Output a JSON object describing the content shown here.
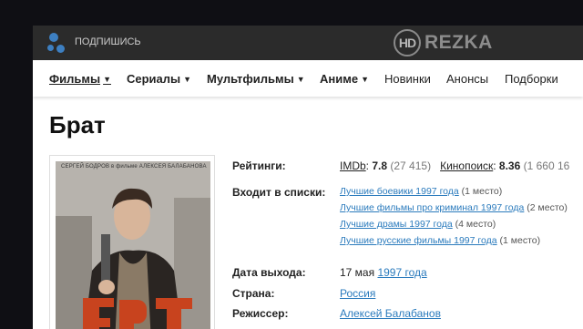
{
  "topbar": {
    "subscribe_label": "ПОДПИШИСЬ",
    "logo_hd": "HD",
    "logo_text": "REZKA"
  },
  "nav": {
    "items": [
      "Фильмы",
      "Сериалы",
      "Мультфильмы",
      "Аниме",
      "Новинки",
      "Анонсы",
      "Подборки"
    ]
  },
  "movie": {
    "title": "Брат",
    "poster_credit": "СЕРГЕЙ БОДРОВ в фильме АЛЕКСЕЯ БАЛАБАНОВА",
    "poster_title": "БРАТ",
    "ratings_label": "Рейтинги:",
    "imdb_label": "IMDb",
    "imdb_value": "7.8",
    "imdb_votes": "(27 415)",
    "kp_label": "Кинопоиск",
    "kp_value": "8.36",
    "kp_votes": "(1 660 16",
    "lists_label": "Входит в списки:",
    "lists": [
      {
        "name": "Лучшие боевики 1997 года",
        "place": "(1 место)"
      },
      {
        "name": "Лучшие фильмы про криминал 1997 года",
        "place": "(2 место)"
      },
      {
        "name": "Лучшие драмы 1997 года",
        "place": "(4 место)"
      },
      {
        "name": "Лучшие русские фильмы 1997 года",
        "place": "(1 место)"
      }
    ],
    "release_label": "Дата выхода:",
    "release_day": "17 мая",
    "release_year": "1997 года",
    "country_label": "Страна:",
    "country": "Россия",
    "director_label": "Режиссер:",
    "director": "Алексей Балабанов"
  },
  "colors": {
    "link": "#2b7bbd",
    "topbar": "#2b2b2b",
    "background": "#0f0f14"
  }
}
